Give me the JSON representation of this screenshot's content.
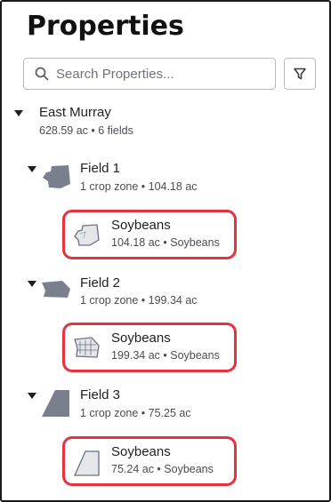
{
  "header": {
    "title": "Properties"
  },
  "search": {
    "placeholder": "Search Properties..."
  },
  "icons": {
    "search": "search-icon",
    "filter": "filter-icon",
    "caret": "caret-down-icon",
    "field_shape": "field-boundary-icon",
    "zone_shape": "crop-zone-boundary-icon"
  },
  "colors": {
    "highlight": "#e8313f",
    "shape_fill": "#7a7f8e",
    "zone_shape_fill": "#e4e6ea"
  },
  "farm": {
    "name": "East Murray",
    "summary": "628.59 ac • 6 fields"
  },
  "fields": [
    {
      "name": "Field 1",
      "summary": "1 crop zone • 104.18 ac",
      "zone": {
        "crop": "Soybeans",
        "summary": "104.18 ac • Soybeans"
      }
    },
    {
      "name": "Field 2",
      "summary": "1 crop zone • 199.34 ac",
      "zone": {
        "crop": "Soybeans",
        "summary": "199.34 ac • Soybeans"
      }
    },
    {
      "name": "Field 3",
      "summary": "1 crop zone • 75.25 ac",
      "zone": {
        "crop": "Soybeans",
        "summary": "75.24 ac • Soybeans"
      }
    }
  ]
}
